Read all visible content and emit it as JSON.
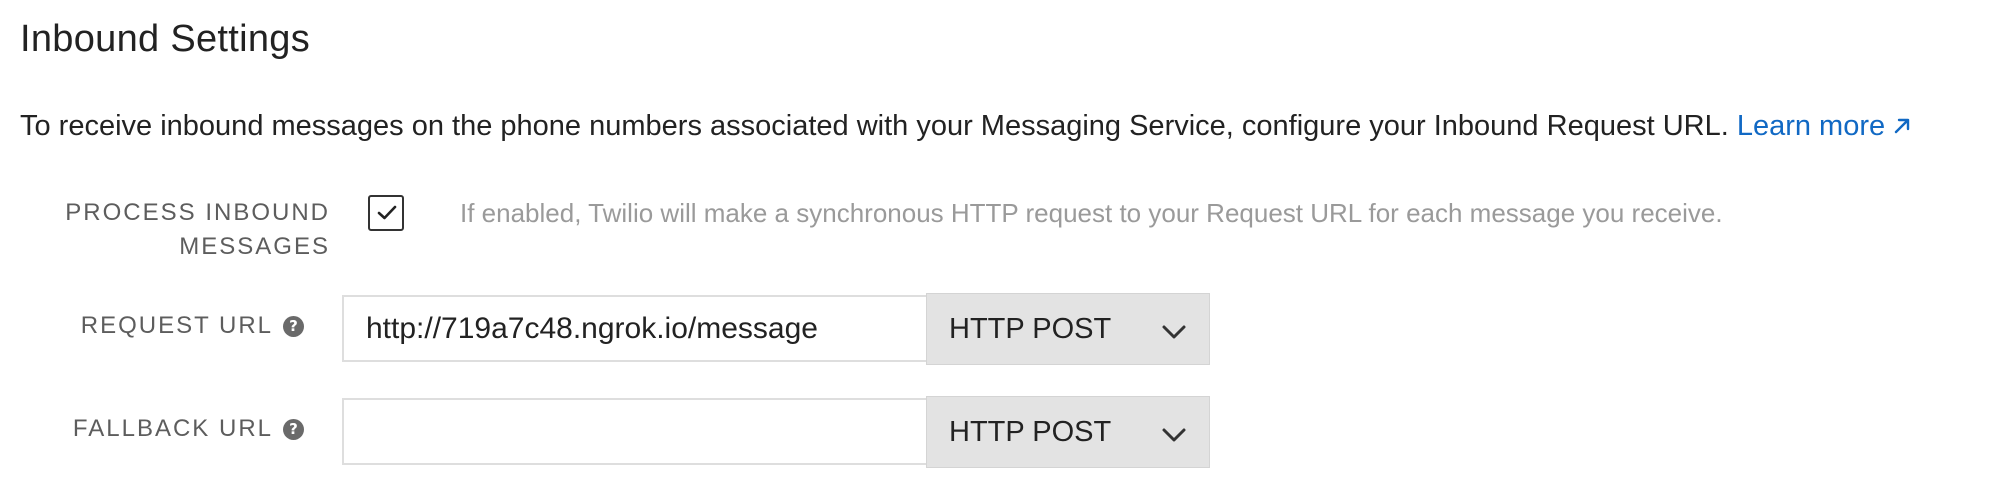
{
  "header": {
    "title": "Inbound Settings"
  },
  "intro": {
    "text": "To receive inbound messages on the phone numbers associated with your Messaging Service, configure your Inbound Request URL.",
    "link_label": "Learn more",
    "link_icon": "external-link-icon",
    "link_color": "#1169c4"
  },
  "process_inbound": {
    "label_line1": "PROCESS INBOUND",
    "label_line2": "MESSAGES",
    "checked": true,
    "hint": "If enabled, Twilio will make a synchronous HTTP request to your Request URL for each message you receive."
  },
  "request_url": {
    "label": "REQUEST URL",
    "help_icon": "help-icon",
    "value": "http://719a7c48.ngrok.io/message",
    "method": "HTTP POST"
  },
  "fallback_url": {
    "label": "FALLBACK URL",
    "help_icon": "help-icon",
    "value": "",
    "method": "HTTP POST"
  }
}
